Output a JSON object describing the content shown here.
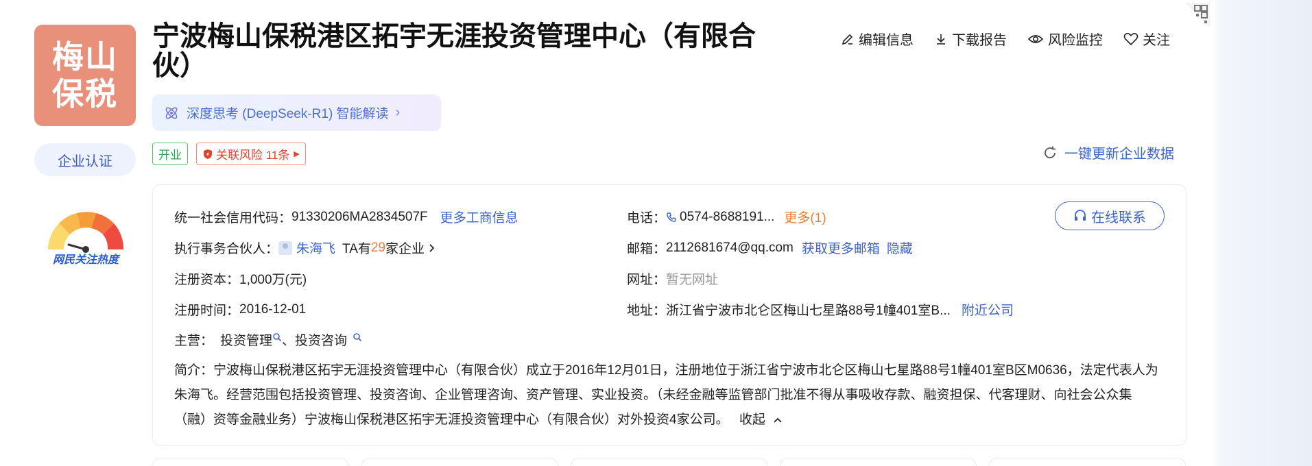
{
  "company": {
    "logo_line1": "梅山",
    "logo_line2": "保税",
    "name": "宁波梅山保税港区拓宇无涯投资管理中心（有限合伙）",
    "cert_label": "企业认证",
    "heat_label": "网民关注热度"
  },
  "ai": {
    "label": "深度思考 (DeepSeek-R1) 智能解读",
    "chevron": "›"
  },
  "actions": {
    "edit": "编辑信息",
    "download": "下载报告",
    "monitor": "风险监控",
    "follow": "关注"
  },
  "tags": {
    "status": "开业",
    "risk": "关联风险 11条",
    "risk_arrow": "▶"
  },
  "refresh_label": "一键更新企业数据",
  "info": {
    "credit_code_label": "统一社会信用代码：",
    "credit_code": "91330206MA2834507F",
    "more_business": "更多工商信息",
    "partner_label": "执行事务合伙人：",
    "partner_name": "朱海飞",
    "partner_ta_prefix": "TA有",
    "partner_count": "29",
    "partner_ta_suffix": "家企业",
    "capital_label": "注册资本：",
    "capital": "1,000万(元)",
    "reg_time_label": "注册时间：",
    "reg_time": "2016-12-01",
    "main_label": "主营：",
    "main_item1": "投资管理",
    "main_sep": "、",
    "main_item2": "投资咨询",
    "phone_label": "电话：",
    "phone": "0574-8688191...",
    "phone_more": "更多(1)",
    "email_label": "邮箱：",
    "email": "2112681674@qq.com",
    "email_more": "获取更多邮箱",
    "email_hide": "隐藏",
    "website_label": "网址：",
    "website": "暂无网址",
    "address_label": "地址：",
    "address": "浙江省宁波市北仑区梅山七星路88号1幢401室B...",
    "address_nearby": "附近公司",
    "online_contact": "在线联系",
    "desc_label": "简介：",
    "desc_text": "宁波梅山保税港区拓宇无涯投资管理中心（有限合伙）成立于2016年12月01日，注册地位于浙江省宁波市北仑区梅山七星路88号1幢401室B区M0636，法定代表人为朱海飞。经营范围包括投资管理、投资咨询、企业管理咨询、资产管理、实业投资。（未经金融等监管部门批准不得从事吸收存款、融资担保、代客理财、向社会公众集（融）资等金融业务）宁波梅山保税港区拓宇无涯投资管理中心（有限合伙）对外投资4家公司。",
    "collapse": "收起"
  },
  "colors": {
    "logo_bg": "#e8907a",
    "link": "#3d64d0",
    "orange": "#f07b2b",
    "status_green": "#33a34d",
    "risk_red": "#e0432b"
  },
  "icons": [
    "qr-code-icon",
    "edit-icon",
    "download-icon",
    "eye-icon",
    "heart-icon",
    "atom-icon",
    "refresh-icon",
    "phone-icon",
    "headset-icon",
    "search-icon",
    "chevron-right-icon",
    "chevron-up-icon",
    "shield-icon"
  ]
}
